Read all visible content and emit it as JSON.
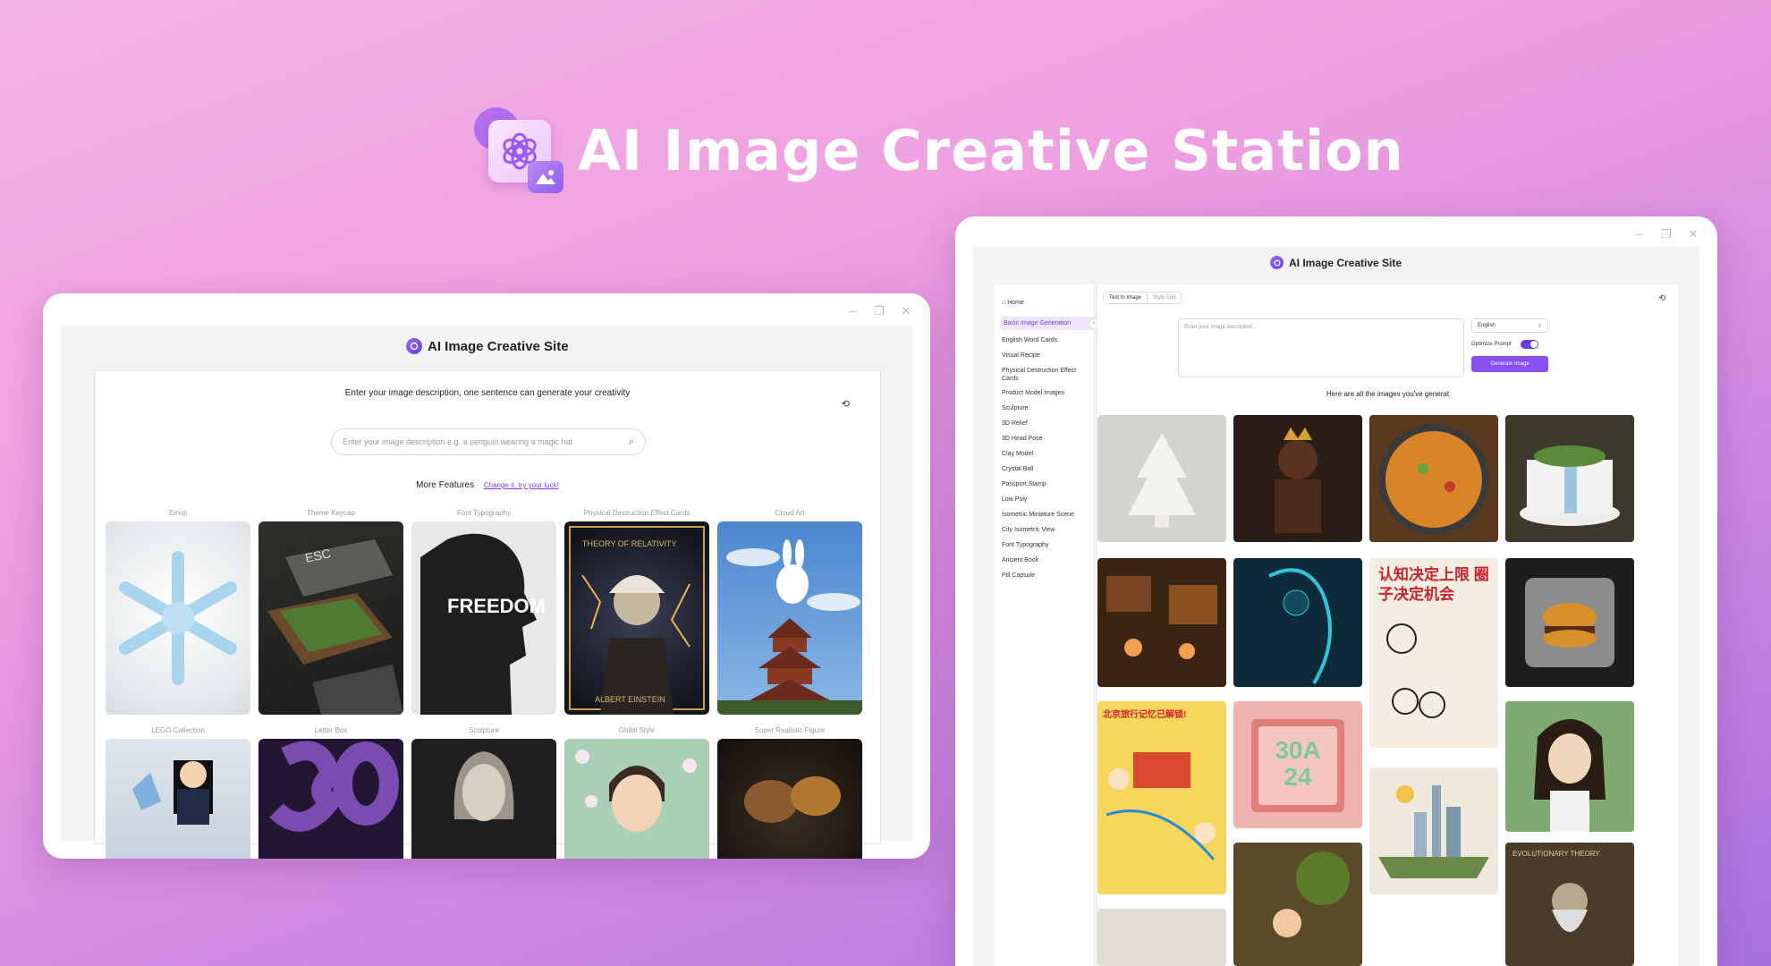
{
  "hero": {
    "title": "AI Image Creative Station"
  },
  "window_controls": {
    "minimize": "–",
    "restore": "❐",
    "close": "✕"
  },
  "left_window": {
    "site_title": "AI Image Creative Site",
    "prompt_text": "Enter your image description, one sentence can generate your creativity",
    "search_placeholder": "Enter your image description e.g. a penguin wearing a magic hat",
    "more_features_label": "More Features",
    "change_link": "Change it, try your luck!",
    "cards": [
      {
        "label": "Emoji",
        "color": "#e9eef0"
      },
      {
        "label": "Theme Keycap",
        "color": "#3a3d38"
      },
      {
        "label": "Font Typography",
        "color": "#d9d9d9"
      },
      {
        "label": "Physical Destruction Effect Cards",
        "color": "#1d2030"
      },
      {
        "label": "Cloud Art",
        "color": "#6fa0d8"
      },
      {
        "label": "LEGO Collection",
        "color": "#c9d6e2"
      },
      {
        "label": "Letter Box",
        "color": "#3b2353"
      },
      {
        "label": "Sculpture",
        "color": "#2a2a2a"
      },
      {
        "label": "Ghibli Style",
        "color": "#b6d4b8"
      },
      {
        "label": "Super Realistic Figure",
        "color": "#241c16"
      }
    ]
  },
  "right_window": {
    "site_title": "AI Image Creative Site",
    "sidebar": {
      "home": "Home",
      "items": [
        "Basic Image Generation",
        "English Word Cards",
        "Visual Recipe",
        "Physical Destruction Effect Cards",
        "Product Model Images",
        "Sculpture",
        "3D Relief",
        "3D Head Pose",
        "Clay Model",
        "Crystal Ball",
        "Passport Stamp",
        "Low Poly",
        "Isometric Miniature Scene",
        "City Isometric View",
        "Font Typography",
        "Ancient Book",
        "Pill Capsule"
      ]
    },
    "tabs": [
      "Text to Image",
      "Style Edit"
    ],
    "textarea_placeholder": "Enter your image description...",
    "language": "English",
    "optimize_label": "Optimize Prompt",
    "generate_button": "Generate Image",
    "here_text": "Here are all the images you've generat",
    "tiles": [
      {
        "color": "#d5d3cf"
      },
      {
        "color": "#2b1d16"
      },
      {
        "color": "#5a3a1e"
      },
      {
        "color": "#3d3a2c"
      },
      {
        "color": "#3a2414"
      },
      {
        "color": "#0d2a3a"
      },
      {
        "color": "#f3ede2"
      },
      {
        "color": "#1d1d1d"
      },
      {
        "color": "#f6d65b"
      },
      {
        "color": "#f1b3b0"
      },
      {
        "color": "#efe8dc"
      },
      {
        "color": "#7eaa72"
      },
      {
        "color": "#e0ddd6"
      },
      {
        "color": "#5b4a2a"
      },
      {
        "color": "#e3e0da"
      },
      {
        "color": "#4a3b2a"
      }
    ],
    "tile_texts": {
      "chinese_card_title": "认知决定上限 圈子决定机会",
      "chinese_map_title": "北京旅行记忆已解锁!",
      "number_blocks": "30A 24",
      "book_title": "EVOLUTIONARY THEORY"
    }
  },
  "left_card_texts": {
    "keycap": "ESC",
    "freedom": "FREEDOM",
    "einstein_card_title": "THEORY OF RELATIVITY",
    "einstein_name": "ALBERT EINSTEIN"
  }
}
